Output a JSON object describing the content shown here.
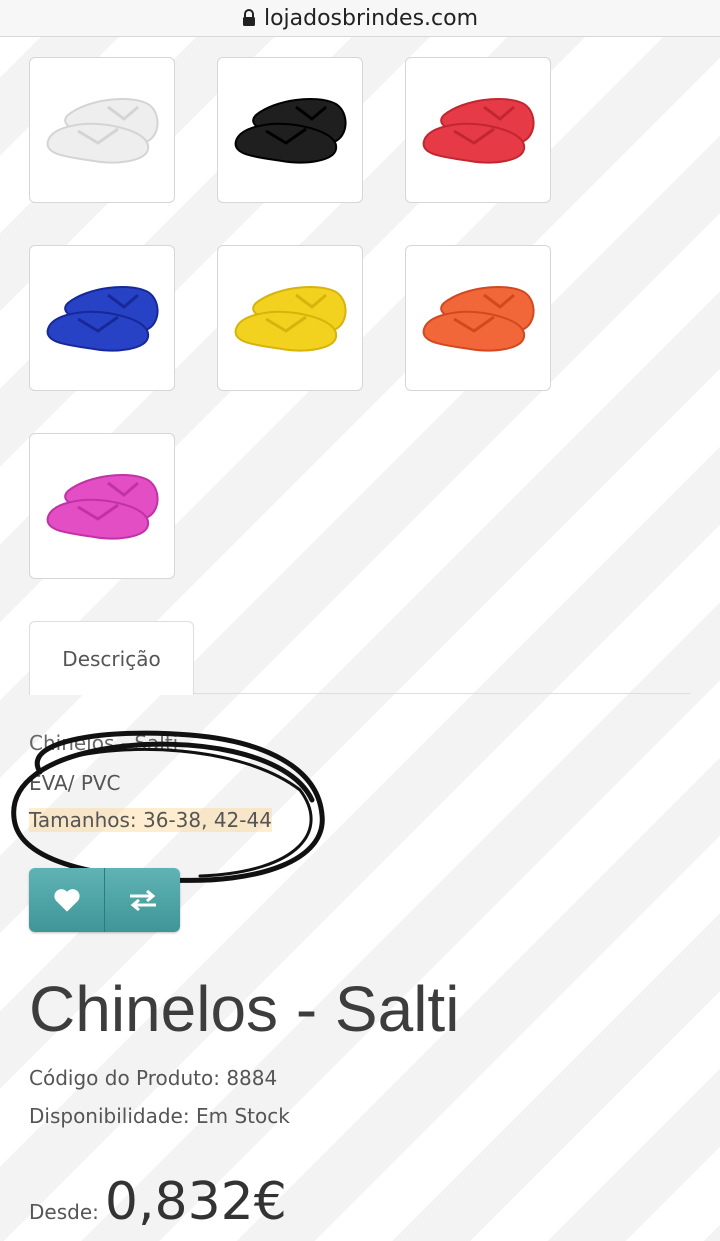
{
  "browser": {
    "url": "lojadosbrindes.com"
  },
  "gallery": {
    "thumbnails": [
      {
        "color": "#eeeeee",
        "accent": "#d4d4d4",
        "icon": "flip-flop-white-icon"
      },
      {
        "color": "#1f1f1f",
        "accent": "#000000",
        "icon": "flip-flop-black-icon"
      },
      {
        "color": "#e63b47",
        "accent": "#c22630",
        "icon": "flip-flop-red-icon"
      },
      {
        "color": "#2742c4",
        "accent": "#17299a",
        "icon": "flip-flop-blue-icon"
      },
      {
        "color": "#f2d21f",
        "accent": "#d6b40b",
        "icon": "flip-flop-yellow-icon"
      },
      {
        "color": "#f2673a",
        "accent": "#d2491f",
        "icon": "flip-flop-orange-icon"
      },
      {
        "color": "#e34ec5",
        "accent": "#c032a5",
        "icon": "flip-flop-pink-icon"
      }
    ]
  },
  "tabs": {
    "description": "Descrição"
  },
  "description": {
    "line1": "Chinelos - Salti",
    "line2": "EVA/ PVC",
    "line3": "Tamanhos: 36-38, 42-44"
  },
  "actions": {
    "wishlist_icon": "heart-icon",
    "compare_icon": "compare-arrows-icon",
    "button_color": "#4fa5a7"
  },
  "product": {
    "title": "Chinelos - Salti",
    "code_label": "Código do Produto:",
    "code": "8884",
    "availability_label": "Disponibilidade:",
    "availability": "Em Stock",
    "price_label": "Desde:",
    "price": "0,832€"
  },
  "annotation": {
    "color": "#111111",
    "shape": "hand-drawn-ellipse"
  }
}
